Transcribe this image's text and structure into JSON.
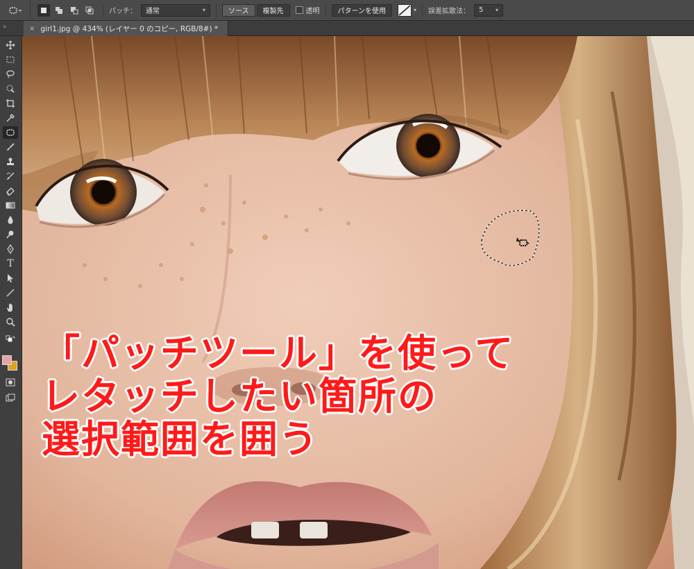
{
  "optionsbar": {
    "patch_label": "パッチ：",
    "patch_mode": "通常",
    "source_button": "ソース",
    "destination_button": "複製先",
    "transparent_label": "透明",
    "use_pattern_button": "パターンを使用",
    "diffusion_label": "誤差拡散法：",
    "diffusion_value": "5"
  },
  "document": {
    "tab_title": "girl1.jpg @ 434% (レイヤー 0 のコピー, RGB/8#) *",
    "close_glyph": "×",
    "collapse_glyph": "»"
  },
  "toolbar": {
    "icons": [
      "move-icon",
      "marquee-icon",
      "lasso-icon",
      "quick-select-icon",
      "crop-icon",
      "eyedropper-icon",
      "patch-tool-icon",
      "brush-icon",
      "stamp-icon",
      "history-brush-icon",
      "eraser-icon",
      "gradient-icon",
      "blur-icon",
      "dodge-icon",
      "pen-icon",
      "type-icon",
      "path-select-icon",
      "line-icon",
      "hand-icon",
      "zoom-icon"
    ],
    "type_glyph": "T",
    "foreground_color": "#e8a3a8",
    "background_color": "#e0a020"
  },
  "caption": {
    "line1": "「パッチツール」を使って",
    "line2": "レタッチしたい箇所の",
    "line3": "選択範囲を囲う",
    "color": "#ff1a1a"
  }
}
